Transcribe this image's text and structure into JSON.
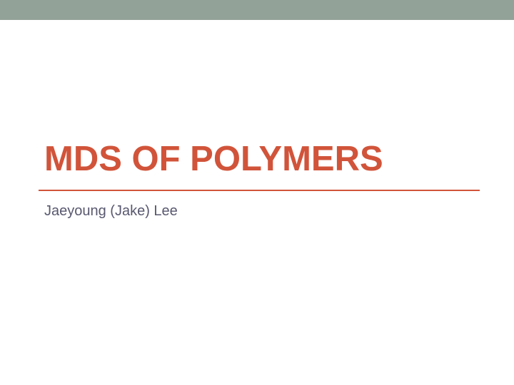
{
  "slide": {
    "title": "MDS OF POLYMERS",
    "subtitle": "Jaeyoung (Jake) Lee"
  },
  "colors": {
    "top_band": "#93a299",
    "title": "#d1543a",
    "rule": "#d1543a",
    "subtitle": "#585870",
    "background": "#ffffff"
  }
}
